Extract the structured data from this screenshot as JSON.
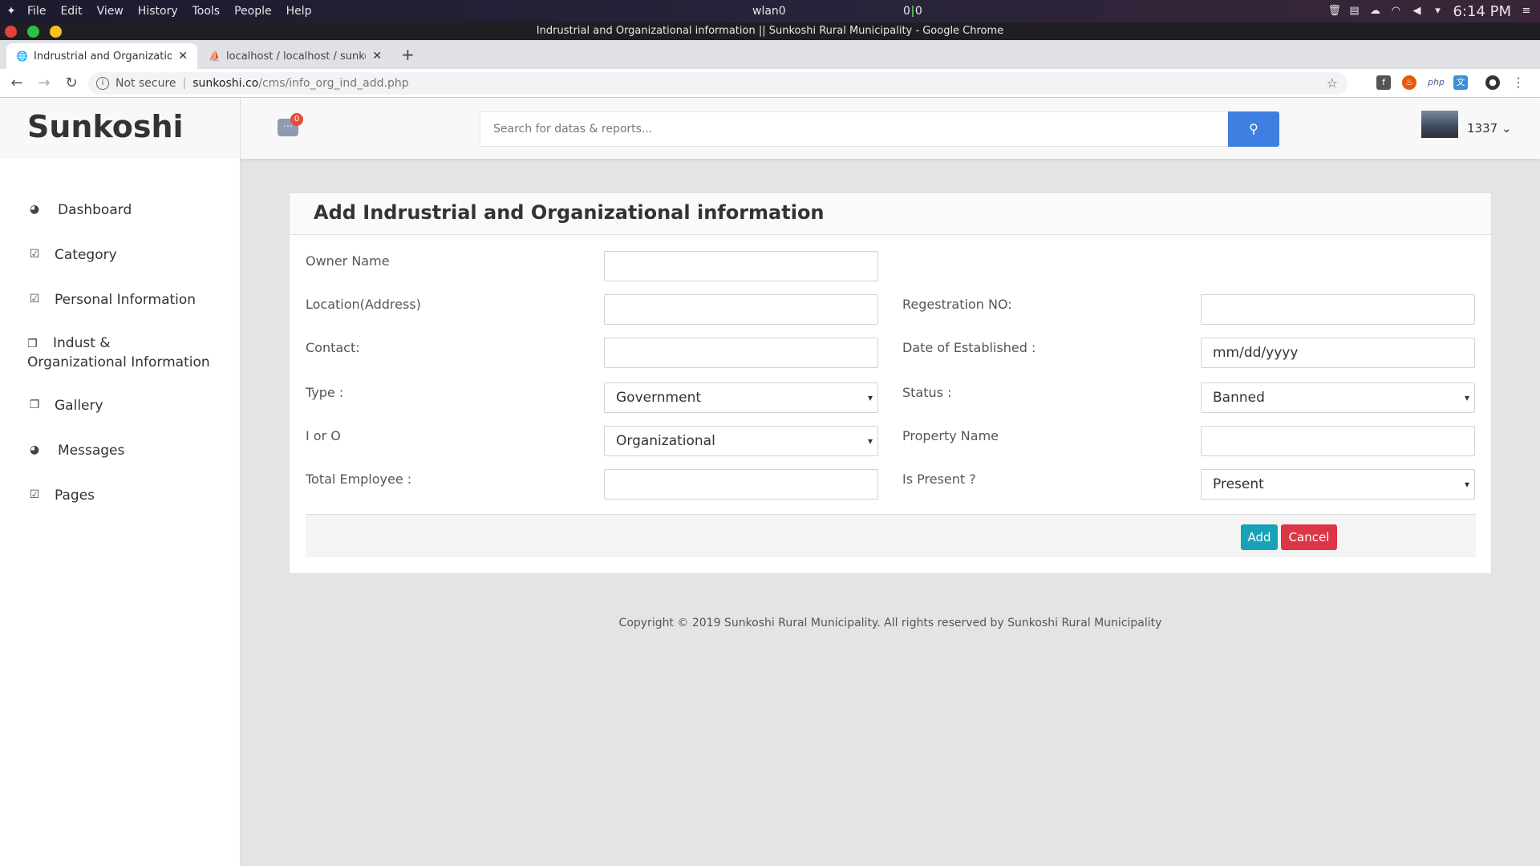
{
  "os": {
    "menu": [
      "File",
      "Edit",
      "View",
      "History",
      "Tools",
      "People",
      "Help"
    ],
    "network_label": "wlan0",
    "net_up": "0",
    "net_down": "0",
    "time": "6:14 PM"
  },
  "window": {
    "title": "Indrustrial and Organizational information || Sunkoshi Rural Municipality - Google Chrome"
  },
  "tabs": [
    {
      "label": "Indrustrial and Organizational information",
      "active": true
    },
    {
      "label": "localhost / localhost / sunkoshi",
      "active": false
    }
  ],
  "address": {
    "security": "Not secure",
    "host": "sunkoshi.co",
    "path": "/cms/info_org_ind_add.php"
  },
  "header": {
    "brand": "Sunkoshi",
    "message_count": "0",
    "search_placeholder": "Search for datas & reports...",
    "user_name": "1337"
  },
  "sidebar": {
    "items": [
      {
        "label": "Dashboard",
        "icon": "dashboard-icon"
      },
      {
        "label": "Category",
        "icon": "checkbox-icon"
      },
      {
        "label": "Personal Information",
        "icon": "checkbox-icon"
      },
      {
        "label": "Indust & Organizational Information",
        "icon": "copy-icon"
      },
      {
        "label": "Gallery",
        "icon": "copy-icon"
      },
      {
        "label": "Messages",
        "icon": "dashboard-icon"
      },
      {
        "label": "Pages",
        "icon": "checkbox-icon"
      }
    ]
  },
  "form": {
    "title": "Add Indrustrial and Organizational information",
    "owner_name_label": "Owner Name",
    "location_label": "Location(Address)",
    "registration_label": "Regestration NO:",
    "contact_label": "Contact:",
    "date_label": "Date of Established :",
    "date_placeholder": "mm/dd/yyyy",
    "type_label": "Type :",
    "type_value": "Government",
    "status_label": "Status :",
    "status_value": "Banned",
    "ioro_label": "I or O",
    "ioro_value": "Organizational",
    "property_label": "Property Name",
    "employee_label": "Total Employee :",
    "present_label": "Is Present ?",
    "present_value": "Present",
    "add_label": "Add",
    "cancel_label": "Cancel"
  },
  "footer": {
    "copyright": "Copyright © 2019 Sunkoshi Rural Municipality. All rights reserved by Sunkoshi Rural Municipality"
  }
}
